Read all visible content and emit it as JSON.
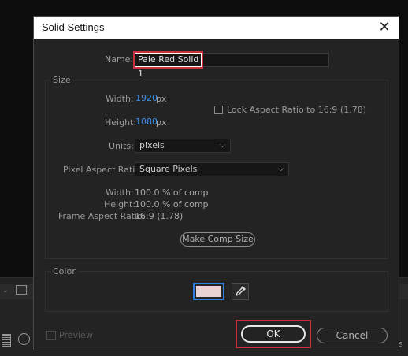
{
  "dialog": {
    "title": "Solid Settings",
    "close_symbol": "✕",
    "name_label": "Name:",
    "name_value": "Pale Red Solid 1",
    "size": {
      "group_label": "Size",
      "width_label": "Width:",
      "width_value": "1920",
      "width_unit": "px",
      "height_label": "Height:",
      "height_value": "1080",
      "height_unit": "px",
      "lock_label": "Lock Aspect Ratio to 16:9 (1.78)",
      "lock_checked": false,
      "units_label": "Units:",
      "units_value": "pixels",
      "par_label": "Pixel Aspect Ratio:",
      "par_value": "Square Pixels",
      "info_width_label": "Width:",
      "info_width_value": "100.0 % of comp",
      "info_height_label": "Height:",
      "info_height_value": "100.0 % of comp",
      "info_far_label": "Frame Aspect Ratio:",
      "info_far_value": "16:9 (1.78)",
      "make_comp_size_label": "Make Comp Size"
    },
    "color": {
      "group_label": "Color",
      "swatch_color": "#e8d2d2",
      "accent": "#2f7de0"
    },
    "footer": {
      "preview_label": "Preview",
      "ok_label": "OK",
      "cancel_label": "Cancel"
    },
    "highlight_color": "#c9303a"
  },
  "background": {
    "status_letter": "s"
  }
}
